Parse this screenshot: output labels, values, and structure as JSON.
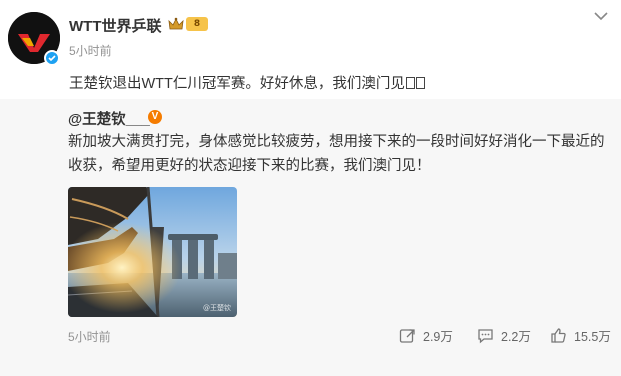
{
  "author": {
    "name": "WTT世界乒联",
    "time": "5小时前",
    "rank_badge": "8"
  },
  "post": {
    "text": "王楚钦退出WTT仁川冠军赛。好好休息，我们澳门见"
  },
  "repost": {
    "author": "@王楚钦___",
    "author_badge": "V",
    "text": "新加坡大满贯打完，身体感觉比较疲劳，想用接下来的一段时间好好消化一下最近的收获，希望用更好的状态迎接下来的比赛，我们澳门见！",
    "image_watermark": "@王楚钦",
    "time": "5小时前",
    "actions": {
      "reposts": "2.9万",
      "comments": "2.2万",
      "likes": "15.5万"
    }
  },
  "colors": {
    "verified_blue": "#1da1f2",
    "badge_orange": "#f57c00",
    "card_background": "#f7f7f7",
    "meta_gray": "#939393"
  },
  "icons": [
    "chevron-down-icon",
    "crown-icon",
    "verified-icon",
    "repost-icon",
    "comment-icon",
    "like-icon"
  ]
}
